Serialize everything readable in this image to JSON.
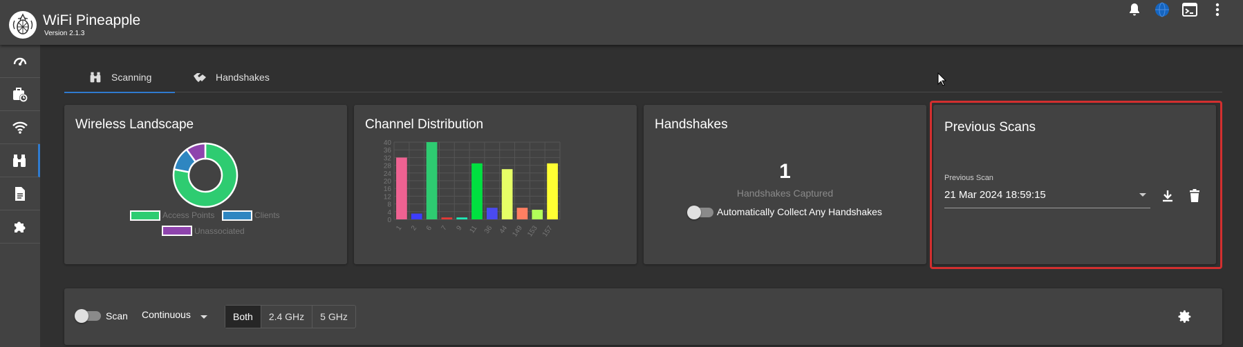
{
  "app": {
    "title": "WiFi Pineapple",
    "version": "Version 2.1.3"
  },
  "topbar": {
    "icons": [
      "bell-icon",
      "globe-icon",
      "terminal-icon",
      "more-vert-icon"
    ]
  },
  "sidebar": {
    "items": [
      {
        "name": "dashboard-icon"
      },
      {
        "name": "campaigns-icon"
      },
      {
        "name": "wifi-icon"
      },
      {
        "name": "recon-icon",
        "active": true
      },
      {
        "name": "logs-icon"
      },
      {
        "name": "modules-icon"
      }
    ]
  },
  "tabs": [
    {
      "label": "Scanning",
      "active": true
    },
    {
      "label": "Handshakes",
      "active": false
    }
  ],
  "wireless_landscape": {
    "title": "Wireless Landscape",
    "legend": [
      {
        "label": "Access Points",
        "color": "#2ecc71"
      },
      {
        "label": "Clients",
        "color": "#2e86c1"
      },
      {
        "label": "Unassociated",
        "color": "#8e44ad"
      }
    ],
    "chart_data": {
      "type": "pie",
      "labels": [
        "Access Points",
        "Clients",
        "Unassociated"
      ],
      "values": [
        78,
        12,
        10
      ],
      "colors": [
        "#2ecc71",
        "#2e86c1",
        "#8e44ad"
      ]
    }
  },
  "channel_distribution": {
    "title": "Channel Distribution",
    "chart_data": {
      "type": "bar",
      "categories": [
        "1",
        "2",
        "6",
        "7",
        "9",
        "11",
        "36",
        "44",
        "149",
        "153",
        "157"
      ],
      "values": [
        32,
        3,
        40,
        1,
        1,
        29,
        6,
        26,
        6,
        5,
        29
      ],
      "colors": [
        "#f06292",
        "#3d3dff",
        "#2ecc71",
        "#e53935",
        "#1de9b6",
        "#00e040",
        "#4a4af0",
        "#e6ff66",
        "#ff7f62",
        "#b2ff59",
        "#ffff33"
      ],
      "yticks": [
        0,
        4,
        8,
        12,
        16,
        20,
        24,
        28,
        32,
        36,
        40
      ],
      "ylim": [
        0,
        40
      ]
    }
  },
  "handshakes": {
    "title": "Handshakes",
    "count": "1",
    "count_label": "Handshakes Captured",
    "auto_collect_label": "Automatically Collect Any Handshakes"
  },
  "previous_scans": {
    "title": "Previous Scans",
    "field_label": "Previous Scan",
    "selected": "21 Mar 2024 18:59:15"
  },
  "scan_controls": {
    "scan_label": "Scan",
    "mode": "Continuous",
    "bands": [
      {
        "label": "Both",
        "active": true
      },
      {
        "label": "2.4 GHz",
        "active": false
      },
      {
        "label": "5 GHz",
        "active": false
      }
    ]
  }
}
